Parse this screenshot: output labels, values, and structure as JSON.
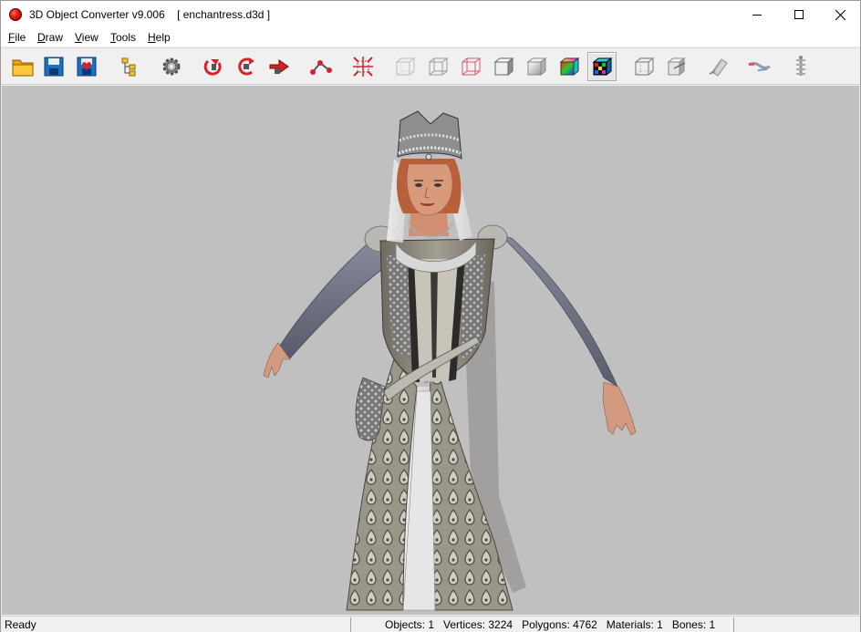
{
  "window": {
    "title": "3D Object Converter v9.006    [ enchantress.d3d ]"
  },
  "menu": {
    "items": [
      {
        "mnemonic": "F",
        "rest": "ile"
      },
      {
        "mnemonic": "D",
        "rest": "raw"
      },
      {
        "mnemonic": "V",
        "rest": "iew"
      },
      {
        "mnemonic": "T",
        "rest": "ools"
      },
      {
        "mnemonic": "H",
        "rest": "elp"
      }
    ]
  },
  "toolbar": {
    "buttons": [
      {
        "icon": "open-folder-icon"
      },
      {
        "icon": "save-icon"
      },
      {
        "icon": "save-as-icon"
      },
      {
        "icon": "object-tree-icon"
      },
      {
        "icon": "settings-gear-icon"
      },
      {
        "icon": "rotate-y-icon"
      },
      {
        "icon": "rotate-x-icon"
      },
      {
        "icon": "move-arrow-icon"
      },
      {
        "icon": "vertex-edit-icon"
      },
      {
        "icon": "scale-icon"
      },
      {
        "icon": "bounding-box-icon"
      },
      {
        "icon": "wireframe-box-icon"
      },
      {
        "icon": "wireframe-red-box-icon"
      },
      {
        "icon": "flat-shaded-box-icon"
      },
      {
        "icon": "smooth-shaded-box-icon"
      },
      {
        "icon": "color-shaded-box-icon"
      },
      {
        "icon": "textured-box-icon"
      },
      {
        "icon": "backface-box-icon"
      },
      {
        "icon": "normals-box-icon"
      },
      {
        "icon": "texture-map-icon"
      },
      {
        "icon": "uv-map-icon"
      },
      {
        "icon": "bones-icon"
      }
    ],
    "active_index": 16
  },
  "status": {
    "ready": "Ready",
    "stats": "Objects: 1   Vertices: 3224   Polygons: 4762   Materials: 1   Bones: 1"
  },
  "colors": {
    "viewport_bg": "#c0c0c0",
    "gown_main": "#8a8578",
    "sleeve": "#6e7182",
    "skin": "#d79a7c",
    "hair": "#b8603a"
  }
}
